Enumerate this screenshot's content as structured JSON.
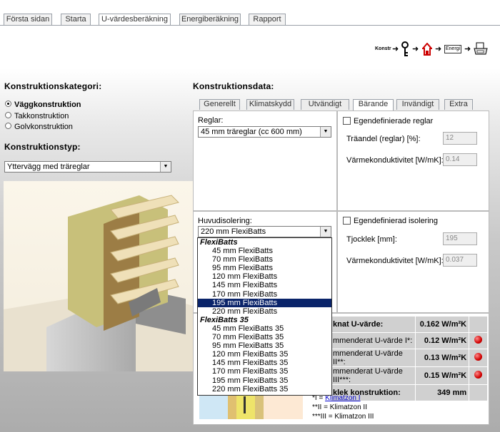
{
  "nav": {
    "tabs": [
      {
        "label": "Första sidan"
      },
      {
        "label": "Starta"
      },
      {
        "label": "U-värdesberäkning"
      },
      {
        "label": "Energiberäkning"
      },
      {
        "label": "Rapport"
      }
    ],
    "active_index": 2
  },
  "flow": {
    "step1": "Konstr",
    "step3": "Energi",
    "icons": [
      "key-icon",
      "house-icon",
      "printer-icon"
    ]
  },
  "left": {
    "kategori_title": "Konstruktionskategori:",
    "options": [
      {
        "label": "Väggkonstruktion",
        "selected": true
      },
      {
        "label": "Takkonstruktion",
        "selected": false
      },
      {
        "label": "Golvkonstruktion",
        "selected": false
      }
    ],
    "typ_title": "Konstruktionstyp:",
    "typ_value": "Yttervägg med träreglar"
  },
  "right": {
    "title": "Konstruktionsdata:",
    "subtabs": [
      "Generellt",
      "Klimatskydd",
      "Utvändigt",
      "Bärande",
      "Invändigt",
      "Extra"
    ],
    "active_subtab": 3,
    "reglar": {
      "label": "Reglar:",
      "value": "45 mm träreglar (cc 600 mm)",
      "custom_label": "Egendefinierade reglar",
      "traandel_label": "Träandel (reglar) [%]:",
      "traandel_value": "12",
      "varme_label": "Värmekonduktivitet [W/mK]:",
      "varme_value": "0.14"
    },
    "isolering": {
      "label": "Huvudisolering:",
      "value": "220 mm FlexiBatts",
      "custom_label": "Egendefinierad isolering",
      "tjocklek_label": "Tjocklek [mm]:",
      "tjocklek_value": "195",
      "varme_label": "Värmekonduktivitet [W/mK]:",
      "varme_value": "0.037"
    },
    "results": [
      {
        "label": "knat U-värde:",
        "value": "0.162 W/m²K",
        "dot": false
      },
      {
        "label": "mmenderat U-värde I*:",
        "value": "0.12 W/m²K",
        "dot": true
      },
      {
        "label": "mmenderat U-värde II**:",
        "value": "0.13 W/m²K",
        "dot": true
      },
      {
        "label": "mmenderat U-värde III***:",
        "value": "0.15 W/m²K",
        "dot": true
      },
      {
        "label": "klek konstruktion:",
        "value": "349 mm",
        "dot": false
      }
    ],
    "footnotes": {
      "f1_prefix": "*I = ",
      "f1_link": "Klimatzon I",
      "f2": "**II = Klimatzon II",
      "f3": "***III = Klimatzon III"
    }
  },
  "dropdown": {
    "groups": [
      {
        "name": "FlexiBatts",
        "items": [
          "45 mm FlexiBatts",
          "70 mm FlexiBatts",
          "95 mm FlexiBatts",
          "120 mm FlexiBatts",
          "145 mm FlexiBatts",
          "170 mm FlexiBatts",
          "195 mm FlexiBatts",
          "220 mm FlexiBatts"
        ]
      },
      {
        "name": "FlexiBatts 35",
        "items": [
          "45 mm FlexiBatts 35",
          "70 mm FlexiBatts 35",
          "95 mm FlexiBatts 35",
          "120 mm FlexiBatts 35",
          "145 mm FlexiBatts 35",
          "170 mm FlexiBatts 35",
          "195 mm FlexiBatts 35",
          "220 mm FlexiBatts 35"
        ]
      }
    ],
    "highlighted": "195 mm FlexiBatts"
  },
  "colors": {
    "highlight": "#0a246a",
    "status_red": "#d00000",
    "tab_border": "#9aa0a8"
  }
}
